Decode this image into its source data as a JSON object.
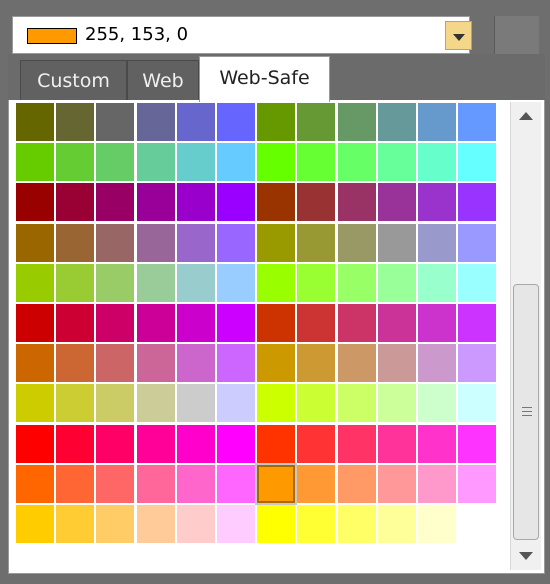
{
  "selected_color": {
    "text": "255, 153, 0",
    "hex": "#ff9900"
  },
  "tabs": [
    {
      "label": "Custom",
      "active": false
    },
    {
      "label": "Web",
      "active": false
    },
    {
      "label": "Web-Safe",
      "active": true
    }
  ],
  "palette": {
    "columns": 12,
    "rows": [
      [
        "#666600",
        "#666633",
        "#666666",
        "#666699",
        "#6666cc",
        "#6666ff",
        "#669900",
        "#669933",
        "#669966",
        "#669999",
        "#6699cc",
        "#6699ff"
      ],
      [
        "#66cc00",
        "#66cc33",
        "#66cc66",
        "#66cc99",
        "#66cccc",
        "#66ccff",
        "#66ff00",
        "#66ff33",
        "#66ff66",
        "#66ff99",
        "#66ffcc",
        "#66ffff"
      ],
      [
        "#990000",
        "#990033",
        "#990066",
        "#990099",
        "#9900cc",
        "#9900ff",
        "#993300",
        "#993333",
        "#993366",
        "#993399",
        "#9933cc",
        "#9933ff"
      ],
      [
        "#996600",
        "#996633",
        "#996666",
        "#996699",
        "#9966cc",
        "#9966ff",
        "#999900",
        "#999933",
        "#999966",
        "#999999",
        "#9999cc",
        "#9999ff"
      ],
      [
        "#99cc00",
        "#99cc33",
        "#99cc66",
        "#99cc99",
        "#99cccc",
        "#99ccff",
        "#99ff00",
        "#99ff33",
        "#99ff66",
        "#99ff99",
        "#99ffcc",
        "#99ffff"
      ],
      [
        "#cc0000",
        "#cc0033",
        "#cc0066",
        "#cc0099",
        "#cc00cc",
        "#cc00ff",
        "#cc3300",
        "#cc3333",
        "#cc3366",
        "#cc3399",
        "#cc33cc",
        "#cc33ff"
      ],
      [
        "#cc6600",
        "#cc6633",
        "#cc6666",
        "#cc6699",
        "#cc66cc",
        "#cc66ff",
        "#cc9900",
        "#cc9933",
        "#cc9966",
        "#cc9999",
        "#cc99cc",
        "#cc99ff"
      ],
      [
        "#cccc00",
        "#cccc33",
        "#cccc66",
        "#cccc99",
        "#cccccc",
        "#ccccff",
        "#ccff00",
        "#ccff33",
        "#ccff66",
        "#ccff99",
        "#ccffcc",
        "#ccffff"
      ],
      [
        "#ff0000",
        "#ff0033",
        "#ff0066",
        "#ff0099",
        "#ff00cc",
        "#ff00ff",
        "#ff3300",
        "#ff3333",
        "#ff3366",
        "#ff3399",
        "#ff33cc",
        "#ff33ff"
      ],
      [
        "#ff6600",
        "#ff6633",
        "#ff6666",
        "#ff6699",
        "#ff66cc",
        "#ff66ff",
        "#ff9900",
        "#ff9933",
        "#ff9966",
        "#ff9999",
        "#ff99cc",
        "#ff99ff"
      ],
      [
        "#ffcc00",
        "#ffcc33",
        "#ffcc66",
        "#ffcc99",
        "#ffcccc",
        "#ffccff",
        "#ffff00",
        "#ffff33",
        "#ffff66",
        "#ffff99",
        "#ffffcc"
      ]
    ],
    "selected": "#ff9900"
  },
  "scrollbar": {
    "up_icon": "arrow-up-icon",
    "down_icon": "arrow-down-icon",
    "grip_icon": "grip-icon"
  }
}
